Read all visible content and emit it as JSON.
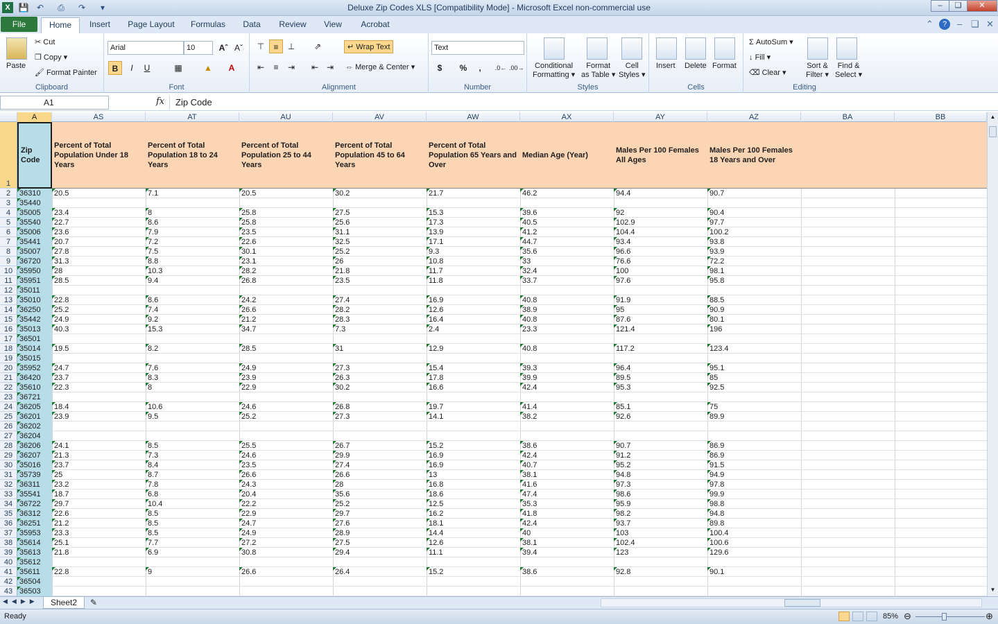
{
  "window": {
    "title": "Deluxe Zip Codes XLS  [Compatibility Mode]  -  Microsoft Excel non-commercial use",
    "app_icon": "excel-icon"
  },
  "tabs": [
    "File",
    "Home",
    "Insert",
    "Page Layout",
    "Formulas",
    "Data",
    "Review",
    "View",
    "Acrobat"
  ],
  "ribbon": {
    "clipboard": {
      "label": "Clipboard",
      "paste": "Paste",
      "cut": "Cut",
      "copy": "Copy",
      "format_painter": "Format Painter"
    },
    "font": {
      "label": "Font",
      "name": "Arial",
      "size": "10",
      "bold": "B",
      "italic": "I",
      "underline": "U"
    },
    "alignment": {
      "label": "Alignment",
      "wrap": "Wrap Text",
      "merge": "Merge & Center"
    },
    "number": {
      "label": "Number",
      "format": "Text",
      "currency": "$",
      "percent": "%",
      "comma": ","
    },
    "styles": {
      "label": "Styles",
      "conditional1": "Conditional",
      "conditional2": "Formatting",
      "table1": "Format",
      "table2": "as Table",
      "cell1": "Cell",
      "cell2": "Styles"
    },
    "cells": {
      "label": "Cells",
      "insert": "Insert",
      "delete": "Delete",
      "format": "Format"
    },
    "editing": {
      "label": "Editing",
      "autosum": "AutoSum",
      "fill": "Fill",
      "clear": "Clear",
      "sort1": "Sort &",
      "sort2": "Filter",
      "find1": "Find &",
      "find2": "Select"
    }
  },
  "formula_bar": {
    "name_box": "A1",
    "fx": "fx",
    "value": "Zip Code"
  },
  "columns": [
    "A",
    "AS",
    "AT",
    "AU",
    "AV",
    "AW",
    "AX",
    "AY",
    "AZ",
    "BA",
    "BB"
  ],
  "headers": [
    "Zip Code",
    "Percent of Total Population Under 18 Years",
    "Percent of Total Population 18 to 24 Years",
    "Percent of Total Population 25 to 44 Years",
    "Percent of Total Population 45 to 64 Years",
    "Percent of Total Population 65 Years and Over",
    "Median Age (Year)",
    "Males Per 100 Females All Ages",
    "Males Per 100 Females 18 Years and Over"
  ],
  "rows": [
    [
      "36310",
      "20.5",
      "7.1",
      "20.5",
      "30.2",
      "21.7",
      "46.2",
      "94.4",
      "90.7"
    ],
    [
      "35440",
      "",
      "",
      "",
      "",
      "",
      "",
      "",
      ""
    ],
    [
      "35005",
      "23.4",
      "8",
      "25.8",
      "27.5",
      "15.3",
      "39.6",
      "92",
      "90.4"
    ],
    [
      "35540",
      "22.7",
      "8.6",
      "25.8",
      "25.6",
      "17.3",
      "40.5",
      "102.9",
      "97.7"
    ],
    [
      "35006",
      "23.6",
      "7.9",
      "23.5",
      "31.1",
      "13.9",
      "41.2",
      "104.4",
      "100.2"
    ],
    [
      "35441",
      "20.7",
      "7.2",
      "22.6",
      "32.5",
      "17.1",
      "44.7",
      "93.4",
      "93.8"
    ],
    [
      "35007",
      "27.8",
      "7.5",
      "30.1",
      "25.2",
      "9.3",
      "35.6",
      "96.6",
      "93.9"
    ],
    [
      "36720",
      "31.3",
      "8.8",
      "23.1",
      "26",
      "10.8",
      "33",
      "76.6",
      "72.2"
    ],
    [
      "35950",
      "28",
      "10.3",
      "28.2",
      "21.8",
      "11.7",
      "32.4",
      "100",
      "98.1"
    ],
    [
      "35951",
      "28.5",
      "9.4",
      "26.8",
      "23.5",
      "11.8",
      "33.7",
      "97.6",
      "95.8"
    ],
    [
      "35011",
      "",
      "",
      "",
      "",
      "",
      "",
      "",
      ""
    ],
    [
      "35010",
      "22.8",
      "8.6",
      "24.2",
      "27.4",
      "16.9",
      "40.8",
      "91.9",
      "88.5"
    ],
    [
      "36250",
      "25.2",
      "7.4",
      "26.6",
      "28.2",
      "12.6",
      "38.9",
      "95",
      "90.9"
    ],
    [
      "35442",
      "24.9",
      "9.2",
      "21.2",
      "28.3",
      "16.4",
      "40.8",
      "87.6",
      "80.1"
    ],
    [
      "35013",
      "40.3",
      "15.3",
      "34.7",
      "7.3",
      "2.4",
      "23.3",
      "121.4",
      "196"
    ],
    [
      "36501",
      "",
      "",
      "",
      "",
      "",
      "",
      "",
      ""
    ],
    [
      "35014",
      "19.5",
      "8.2",
      "28.5",
      "31",
      "12.9",
      "40.8",
      "117.2",
      "123.4"
    ],
    [
      "35015",
      "",
      "",
      "",
      "",
      "",
      "",
      "",
      ""
    ],
    [
      "35952",
      "24.7",
      "7.6",
      "24.9",
      "27.3",
      "15.4",
      "39.3",
      "96.4",
      "95.1"
    ],
    [
      "36420",
      "23.7",
      "8.3",
      "23.9",
      "26.3",
      "17.8",
      "39.9",
      "89.5",
      "85"
    ],
    [
      "35610",
      "22.3",
      "8",
      "22.9",
      "30.2",
      "16.6",
      "42.4",
      "95.3",
      "92.5"
    ],
    [
      "36721",
      "",
      "",
      "",
      "",
      "",
      "",
      "",
      ""
    ],
    [
      "36205",
      "18.4",
      "10.6",
      "24.6",
      "26.8",
      "19.7",
      "41.4",
      "85.1",
      "75"
    ],
    [
      "36201",
      "23.9",
      "9.5",
      "25.2",
      "27.3",
      "14.1",
      "38.2",
      "92.6",
      "89.9"
    ],
    [
      "36202",
      "",
      "",
      "",
      "",
      "",
      "",
      "",
      ""
    ],
    [
      "36204",
      "",
      "",
      "",
      "",
      "",
      "",
      "",
      ""
    ],
    [
      "36206",
      "24.1",
      "8.5",
      "25.5",
      "26.7",
      "15.2",
      "38.6",
      "90.7",
      "86.9"
    ],
    [
      "36207",
      "21.3",
      "7.3",
      "24.6",
      "29.9",
      "16.9",
      "42.4",
      "91.2",
      "86.9"
    ],
    [
      "35016",
      "23.7",
      "8.4",
      "23.5",
      "27.4",
      "16.9",
      "40.7",
      "95.2",
      "91.5"
    ],
    [
      "35739",
      "25",
      "8.7",
      "26.6",
      "26.6",
      "13",
      "38.1",
      "94.8",
      "94.9"
    ],
    [
      "36311",
      "23.2",
      "7.8",
      "24.3",
      "28",
      "16.8",
      "41.6",
      "97.3",
      "97.8"
    ],
    [
      "35541",
      "18.7",
      "6.8",
      "20.4",
      "35.6",
      "18.6",
      "47.4",
      "98.6",
      "99.9"
    ],
    [
      "36722",
      "29.7",
      "10.4",
      "22.2",
      "25.2",
      "12.5",
      "35.3",
      "95.9",
      "98.8"
    ],
    [
      "36312",
      "22.6",
      "8.5",
      "22.9",
      "29.7",
      "16.2",
      "41.8",
      "98.2",
      "94.8"
    ],
    [
      "36251",
      "21.2",
      "8.5",
      "24.7",
      "27.6",
      "18.1",
      "42.4",
      "93.7",
      "89.8"
    ],
    [
      "35953",
      "23.3",
      "8.5",
      "24.9",
      "28.9",
      "14.4",
      "40",
      "103",
      "100.4"
    ],
    [
      "35614",
      "25.1",
      "7.7",
      "27.2",
      "27.5",
      "12.6",
      "38.1",
      "102.4",
      "100.6"
    ],
    [
      "35613",
      "21.8",
      "6.9",
      "30.8",
      "29.4",
      "11.1",
      "39.4",
      "123",
      "129.6"
    ],
    [
      "35612",
      "",
      "",
      "",
      "",
      "",
      "",
      "",
      ""
    ],
    [
      "35611",
      "22.8",
      "9",
      "26.6",
      "26.4",
      "15.2",
      "38.6",
      "92.8",
      "90.1"
    ],
    [
      "36504",
      "",
      "",
      "",
      "",
      "",
      "",
      "",
      ""
    ],
    [
      "36503",
      "",
      "",
      "",
      "",
      "",
      "",
      "",
      ""
    ]
  ],
  "sheet_tab": "Sheet2",
  "status": {
    "ready": "Ready",
    "zoom": "85%"
  }
}
